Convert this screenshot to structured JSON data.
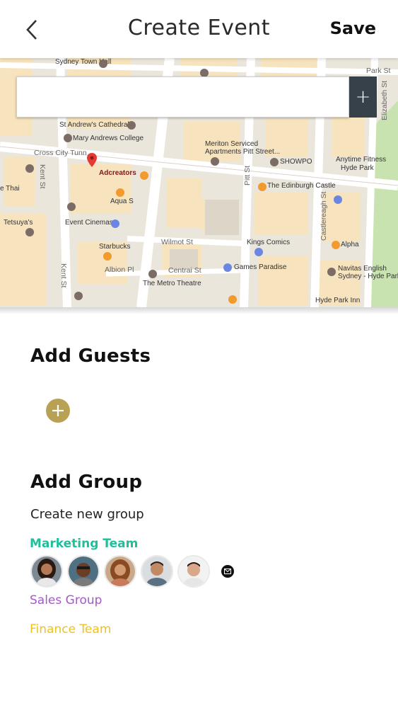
{
  "header": {
    "title": "Create Event",
    "save_label": "Save",
    "back_icon": "chevron-left-icon"
  },
  "map": {
    "search_value": "",
    "add_button_label": "+",
    "labels": {
      "sydney_town_hall": "Sydney Town Hall",
      "park_st": "Park St",
      "st_andrews": "St Andrew's Cathedral",
      "mary_andrews": "Mary Andrews College",
      "cross_city": "Cross City Tunn",
      "meriton": "Meriton Serviced",
      "meriton2": "Apartments Pitt Street...",
      "showpo": "SHOWPO",
      "anytime": "Anytime Fitness",
      "hyde_park": "Hyde Park",
      "adcreators": "Adcreators",
      "kent_st": "Kent St",
      "e_thai": "e Thai",
      "edinburgh": "The Edinburgh Castle",
      "aqua": "Aqua S",
      "tetsuyas": "Tetsuya's",
      "event_cinemas": "Event Cinemas",
      "wilmot": "Wilmot St",
      "kings_comics": "Kings Comics",
      "alpha": "Alpha",
      "starbucks": "Starbucks",
      "albion": "Albion Pl",
      "centrai": "Centrai St",
      "games_paradise": "Games Paradise",
      "navitas1": "Navitas English",
      "navitas2": "Sydney - Hyde Park",
      "metro": "The Metro Theatre",
      "pitt_st": "Pitt St",
      "castlereagh": "Castlereagh St",
      "elizabeth": "Elizabeth St",
      "hyde_park_inn": "Hyde Park Inn",
      "kent_st2": "Kent St"
    }
  },
  "guests": {
    "title": "Add Guests",
    "add_icon": "plus-circle-icon"
  },
  "groups": {
    "title": "Add Group",
    "create_label": "Create new group",
    "items": [
      {
        "name": "Marketing Team",
        "color": "#1fbf9a"
      },
      {
        "name": "Sales Group",
        "color": "#a35ac8"
      },
      {
        "name": "Finance Team",
        "color": "#f0c21c"
      }
    ],
    "message_icon": "envelope-icon"
  },
  "colors": {
    "accent_gold": "#b8a154",
    "search_button": "#36414a"
  }
}
